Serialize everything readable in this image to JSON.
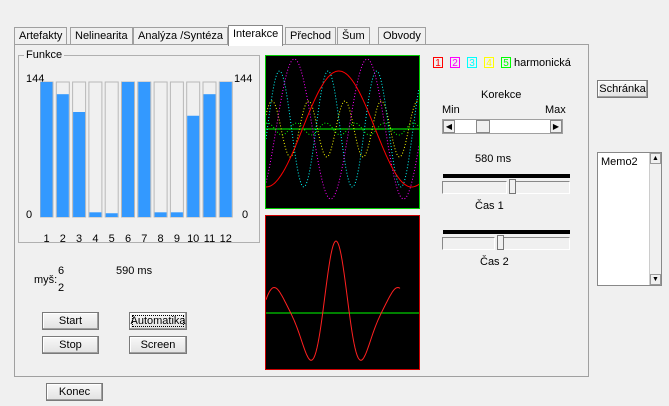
{
  "tabs": [
    "Artefakty",
    "Nelinearita",
    "Analýza /Syntéza",
    "Interakce",
    "Přechod",
    "Šum",
    "Obvody"
  ],
  "active_tab": 3,
  "funkce": {
    "title": "Funkce",
    "left_max": "144",
    "right_max": "144",
    "left_min": "0",
    "right_min": "0",
    "bar_color": "#3399ff",
    "chart_data": {
      "type": "bar",
      "categories": [
        "1",
        "2",
        "3",
        "4",
        "5",
        "6",
        "7",
        "8",
        "9",
        "10",
        "11",
        "12"
      ],
      "values": [
        144,
        131,
        112,
        5,
        4,
        144,
        144,
        5,
        5,
        108,
        131,
        144
      ],
      "ylim": [
        0,
        144
      ]
    }
  },
  "mouse": {
    "label": "myš:",
    "x": "6",
    "y": "2"
  },
  "time_main": "590 ms",
  "buttons": {
    "start": "Start",
    "stop": "Stop",
    "automatika": "Automatika",
    "screen": "Screen",
    "konec": "Konec",
    "schranka": "Schránka"
  },
  "harmonics": {
    "items": [
      {
        "label": "1",
        "color": "#ff0000"
      },
      {
        "label": "2",
        "color": "#ff00ff"
      },
      {
        "label": "3",
        "color": "#00ffff"
      },
      {
        "label": "4",
        "color": "#ffff00"
      },
      {
        "label": "5",
        "color": "#00ff00"
      }
    ],
    "label": "harmonická"
  },
  "korekce": {
    "title": "Korekce",
    "min": "Min",
    "max": "Max",
    "value": 0.25
  },
  "cas1": {
    "time": "580 ms",
    "label": "Čas 1",
    "value": 0.55
  },
  "cas2": {
    "label": "Čas 2",
    "value": 0.45
  },
  "memo": {
    "text": "Memo2"
  }
}
